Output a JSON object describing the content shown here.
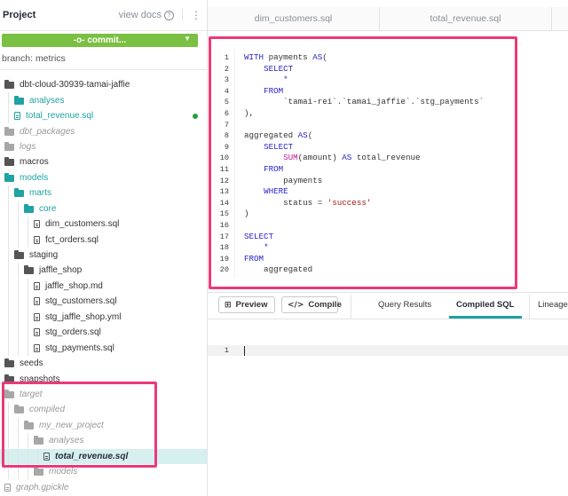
{
  "sidebar": {
    "title": "Project",
    "view_docs": "view docs",
    "commit_label": "-o- commit...",
    "branch": "branch: metrics",
    "tree": [
      {
        "label": "dbt-cloud-30939-tamai-jaffie",
        "type": "folder",
        "indent": 0,
        "style": "normal"
      },
      {
        "label": "analyses",
        "type": "folder",
        "indent": 1,
        "style": "teal"
      },
      {
        "label": "total_revenue.sql",
        "type": "file",
        "indent": 1,
        "style": "teal",
        "modified": true
      },
      {
        "label": "dbt_packages",
        "type": "folder",
        "indent": 0,
        "style": "italic"
      },
      {
        "label": "logs",
        "type": "folder",
        "indent": 0,
        "style": "italic"
      },
      {
        "label": "macros",
        "type": "folder",
        "indent": 0,
        "style": "normal"
      },
      {
        "label": "models",
        "type": "folder",
        "indent": 0,
        "style": "teal"
      },
      {
        "label": "marts",
        "type": "folder",
        "indent": 1,
        "style": "teal"
      },
      {
        "label": "core",
        "type": "folder",
        "indent": 2,
        "style": "teal"
      },
      {
        "label": "dim_customers.sql",
        "type": "file",
        "indent": 3,
        "style": "normal"
      },
      {
        "label": "fct_orders.sql",
        "type": "file",
        "indent": 3,
        "style": "normal"
      },
      {
        "label": "staging",
        "type": "folder",
        "indent": 1,
        "style": "normal"
      },
      {
        "label": "jaffle_shop",
        "type": "folder",
        "indent": 2,
        "style": "normal"
      },
      {
        "label": "jaffle_shop.md",
        "type": "file",
        "indent": 3,
        "style": "normal"
      },
      {
        "label": "stg_customers.sql",
        "type": "file",
        "indent": 3,
        "style": "normal"
      },
      {
        "label": "stg_jaffle_shop.yml",
        "type": "file",
        "indent": 3,
        "style": "normal"
      },
      {
        "label": "stg_orders.sql",
        "type": "file",
        "indent": 3,
        "style": "normal"
      },
      {
        "label": "stg_payments.sql",
        "type": "file",
        "indent": 3,
        "style": "normal"
      },
      {
        "label": "seeds",
        "type": "folder",
        "indent": 0,
        "style": "normal"
      },
      {
        "label": "snapshots",
        "type": "folder",
        "indent": 0,
        "style": "normal"
      },
      {
        "label": "target",
        "type": "folder",
        "indent": 0,
        "style": "italic"
      },
      {
        "label": "compiled",
        "type": "folder",
        "indent": 1,
        "style": "italic"
      },
      {
        "label": "my_new_project",
        "type": "folder",
        "indent": 2,
        "style": "italic"
      },
      {
        "label": "analyses",
        "type": "folder",
        "indent": 3,
        "style": "italic"
      },
      {
        "label": "total_revenue.sql",
        "type": "file",
        "indent": 4,
        "style": "selected"
      },
      {
        "label": "models",
        "type": "folder",
        "indent": 3,
        "style": "italic"
      },
      {
        "label": "graph.gpickle",
        "type": "file",
        "indent": 0,
        "style": "italic"
      }
    ]
  },
  "tabs": [
    "dim_customers.sql",
    "total_revenue.sql"
  ],
  "editor": {
    "lines": [
      [
        [
          "kw",
          "WITH"
        ],
        [
          "plain",
          " payments "
        ],
        [
          "kw",
          "AS"
        ],
        [
          "plain",
          "("
        ]
      ],
      [
        [
          "plain",
          "    "
        ],
        [
          "kw",
          "SELECT"
        ]
      ],
      [
        [
          "plain",
          "        "
        ],
        [
          "kw",
          "*"
        ]
      ],
      [
        [
          "plain",
          "    "
        ],
        [
          "kw",
          "FROM"
        ]
      ],
      [
        [
          "plain",
          "        `tamai-rei`.`tamai_jaffie`.`stg_payments`"
        ]
      ],
      [
        [
          "plain",
          "),"
        ]
      ],
      [],
      [
        [
          "plain",
          "aggregated "
        ],
        [
          "kw",
          "AS"
        ],
        [
          "plain",
          "("
        ]
      ],
      [
        [
          "plain",
          "    "
        ],
        [
          "kw",
          "SELECT"
        ]
      ],
      [
        [
          "plain",
          "        "
        ],
        [
          "fn",
          "SUM"
        ],
        [
          "plain",
          "(amount) "
        ],
        [
          "kw",
          "AS"
        ],
        [
          "plain",
          " total_revenue"
        ]
      ],
      [
        [
          "plain",
          "    "
        ],
        [
          "kw",
          "FROM"
        ]
      ],
      [
        [
          "plain",
          "        payments"
        ]
      ],
      [
        [
          "plain",
          "    "
        ],
        [
          "kw",
          "WHERE"
        ]
      ],
      [
        [
          "plain",
          "        status = "
        ],
        [
          "str",
          "'success'"
        ]
      ],
      [
        [
          "plain",
          ")"
        ]
      ],
      [],
      [
        [
          "kw",
          "SELECT"
        ]
      ],
      [
        [
          "plain",
          "    "
        ],
        [
          "kw",
          "*"
        ]
      ],
      [
        [
          "kw",
          "FROM"
        ]
      ],
      [
        [
          "plain",
          "    aggregated"
        ]
      ]
    ]
  },
  "toolbar": {
    "preview_label": "Preview",
    "compile_label": "Compile",
    "result_tabs": [
      "Query Results",
      "Compiled SQL",
      "Lineage"
    ],
    "active_result_tab": "Compiled SQL"
  },
  "results": {
    "line_number": "1"
  },
  "colors": {
    "accent": "#1fa3a3",
    "commit": "#7ac043",
    "highlight": "#ea3a7a"
  }
}
